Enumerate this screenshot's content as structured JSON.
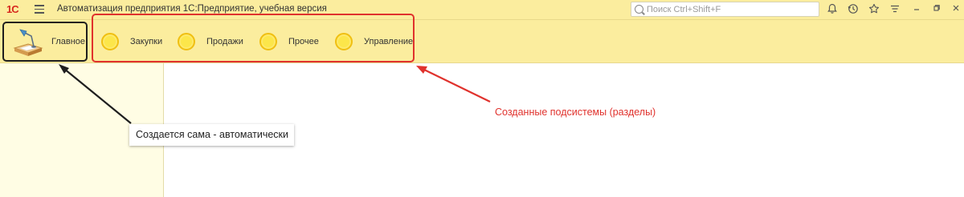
{
  "app": {
    "logo": "1С",
    "title": "Автоматизация предприятия 1С:Предприятие, учебная версия"
  },
  "search": {
    "placeholder": "Поиск Ctrl+Shift+F",
    "value": ""
  },
  "toolbar_icons": [
    "menu-icon",
    "bell-icon",
    "history-icon",
    "star-icon",
    "filter-icon",
    "minimize-icon",
    "restore-icon",
    "close-icon"
  ],
  "sections": {
    "main_label": "Главное",
    "items": [
      {
        "label": "Закупки",
        "icon": "coin-icon"
      },
      {
        "label": "Продажи",
        "icon": "coin-icon"
      },
      {
        "label": "Прочее",
        "icon": "coin-icon"
      },
      {
        "label": "Управление",
        "icon": "coin-icon"
      }
    ]
  },
  "annotations": {
    "created_subsystems": "Созданные подсистемы (разделы)",
    "auto_created": "Создается сама - автоматически"
  },
  "colors": {
    "panel": "#fbed9e",
    "sidebar": "#fffde4",
    "annotation_red": "#e0322d",
    "annotation_black": "#1e1e1e",
    "coin": "#fce64a"
  }
}
